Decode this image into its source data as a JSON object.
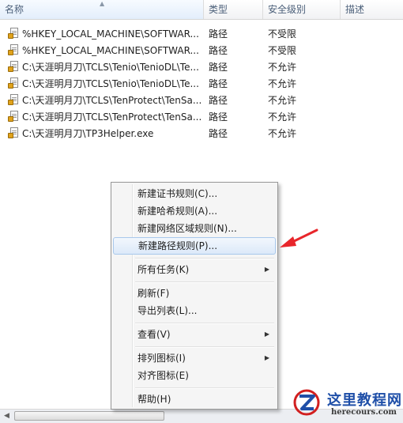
{
  "columns": {
    "name": "名称",
    "type": "类型",
    "level": "安全级别",
    "desc": "描述"
  },
  "rows": [
    {
      "name": "%HKEY_LOCAL_MACHINE\\SOFTWAR...",
      "type": "路径",
      "level": "不受限"
    },
    {
      "name": "%HKEY_LOCAL_MACHINE\\SOFTWAR...",
      "type": "路径",
      "level": "不受限"
    },
    {
      "name": "C:\\天涯明月刀\\TCLS\\Tenio\\TenioDL\\Te...",
      "type": "路径",
      "level": "不允许"
    },
    {
      "name": "C:\\天涯明月刀\\TCLS\\Tenio\\TenioDL\\Te...",
      "type": "路径",
      "level": "不允许"
    },
    {
      "name": "C:\\天涯明月刀\\TCLS\\TenProtect\\TenSa...",
      "type": "路径",
      "level": "不允许"
    },
    {
      "name": "C:\\天涯明月刀\\TCLS\\TenProtect\\TenSa...",
      "type": "路径",
      "level": "不允许"
    },
    {
      "name": "C:\\天涯明月刀\\TP3Helper.exe",
      "type": "路径",
      "level": "不允许"
    }
  ],
  "menu": {
    "new_cert": "新建证书规则(C)...",
    "new_hash": "新建哈希规则(A)...",
    "new_zone": "新建网络区域规则(N)...",
    "new_path": "新建路径规则(P)...",
    "all_tasks": "所有任务(K)",
    "refresh": "刷新(F)",
    "export": "导出列表(L)...",
    "view": "查看(V)",
    "arrange": "排列图标(I)",
    "align": "对齐图标(E)",
    "help": "帮助(H)"
  },
  "watermark": {
    "title": "这里教程网",
    "url": "herecours.com"
  },
  "colors": {
    "highlight": "#dce9f9",
    "arrow": "#e8262b",
    "brand": "#1f4fa8"
  }
}
